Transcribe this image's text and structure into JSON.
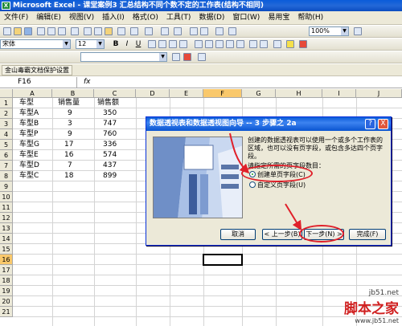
{
  "window": {
    "title": "Microsoft Excel - 课堂案例3  汇总结构不同个数不定的工作表(结构不相同)"
  },
  "menu": [
    "文件(F)",
    "编辑(E)",
    "视图(V)",
    "插入(I)",
    "格式(O)",
    "工具(T)",
    "数据(D)",
    "窗口(W)",
    "易用宝",
    "帮助(H)"
  ],
  "toolbar": {
    "zoom": "100%",
    "font_name": "宋体",
    "font_size": "12",
    "bold": "B",
    "italic": "I",
    "underline": "U"
  },
  "addon_bar": {
    "label": "金山毒霸文档保护设置"
  },
  "formula_bar": {
    "name_box": "F16",
    "fx": "fx"
  },
  "columns": [
    "A",
    "B",
    "C",
    "D",
    "E",
    "F",
    "G",
    "H",
    "I",
    "J"
  ],
  "rows": [
    "1",
    "2",
    "3",
    "4",
    "5",
    "6",
    "7",
    "8",
    "9",
    "10",
    "11",
    "12",
    "13",
    "14",
    "15",
    "16",
    "17",
    "18",
    "19",
    "20",
    "21"
  ],
  "selected": {
    "column": "F",
    "row": "16"
  },
  "table": {
    "headers": [
      "车型",
      "销售量",
      "销售额"
    ],
    "rows": [
      [
        "车型A",
        "9",
        "350"
      ],
      [
        "车型B",
        "3",
        "747"
      ],
      [
        "车型P",
        "9",
        "760"
      ],
      [
        "车型G",
        "17",
        "336"
      ],
      [
        "车型E",
        "16",
        "574"
      ],
      [
        "车型D",
        "7",
        "437"
      ],
      [
        "车型C",
        "18",
        "899"
      ]
    ]
  },
  "dialog": {
    "title": "数据透视表和数据透视图向导 -- 3 步骤之 2a",
    "description": "创建的数据透视表可以使用一个或多个工作表的区域，也可以没有页字段，或包含多达四个页字段。",
    "question": "请指定所需的页字段数目：",
    "option_single": "创建单页字段(C)",
    "option_custom": "自定义页字段(U)",
    "btn_cancel": "取消",
    "btn_back": "< 上一步(B)",
    "btn_next": "下一步(N) >",
    "btn_finish": "完成(F)",
    "help": "?",
    "close": "X"
  },
  "watermark": {
    "site": "jb51.net",
    "brand": "脚本之家",
    "url": "www.jb51.net"
  },
  "colors": {
    "annotation": "#e0202a",
    "title_blue": "#0a5cd9"
  }
}
